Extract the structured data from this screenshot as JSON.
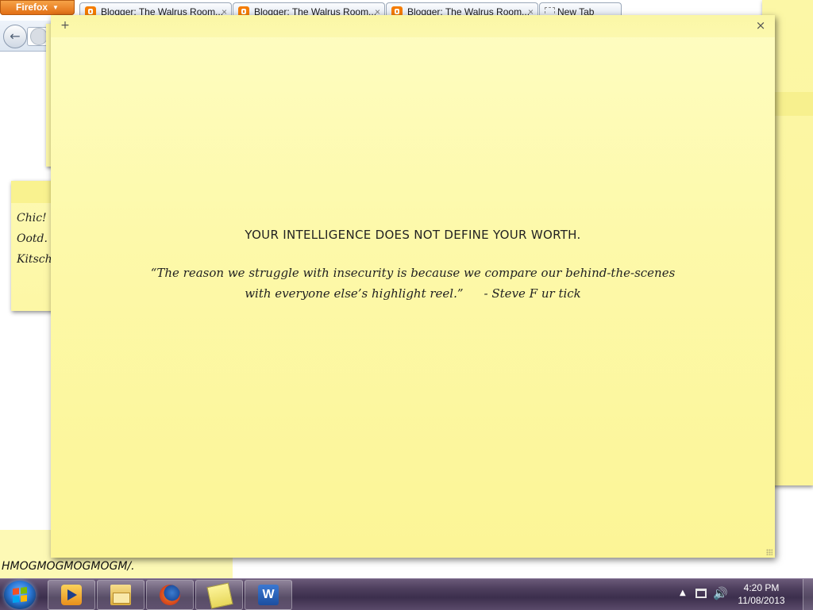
{
  "browser": {
    "menu_button": "Firefox",
    "tabs": [
      {
        "title": "Blogger: The Walrus Room..."
      },
      {
        "title": "Blogger: The Walrus Room..."
      },
      {
        "title": "Blogger: The Walrus Room..."
      },
      {
        "title": "New Tab"
      }
    ]
  },
  "notes": {
    "left_note_lines": [
      "Chic!",
      "Ootd.",
      "Kitsch"
    ],
    "bottom_note_text": "HMOGMOGMOGMOGM/.",
    "main_note": {
      "add_label": "+",
      "close_label": "×",
      "headline": "YOUR INTELLIGENCE DOES NOT DEFINE YOUR WORTH.",
      "quote_line1": "“The reason we struggle with insecurity is because we compare our behind-the-scenes",
      "quote_line2": "with everyone else’s highlight reel.”",
      "attribution": "- Steve F ur tick"
    }
  },
  "taskbar": {
    "icons": [
      "windows-media-player-icon",
      "windows-explorer-icon",
      "firefox-icon",
      "sticky-notes-icon",
      "microsoft-word-icon"
    ],
    "clock_time": "4:20 PM",
    "clock_date": "11/08/2013"
  }
}
